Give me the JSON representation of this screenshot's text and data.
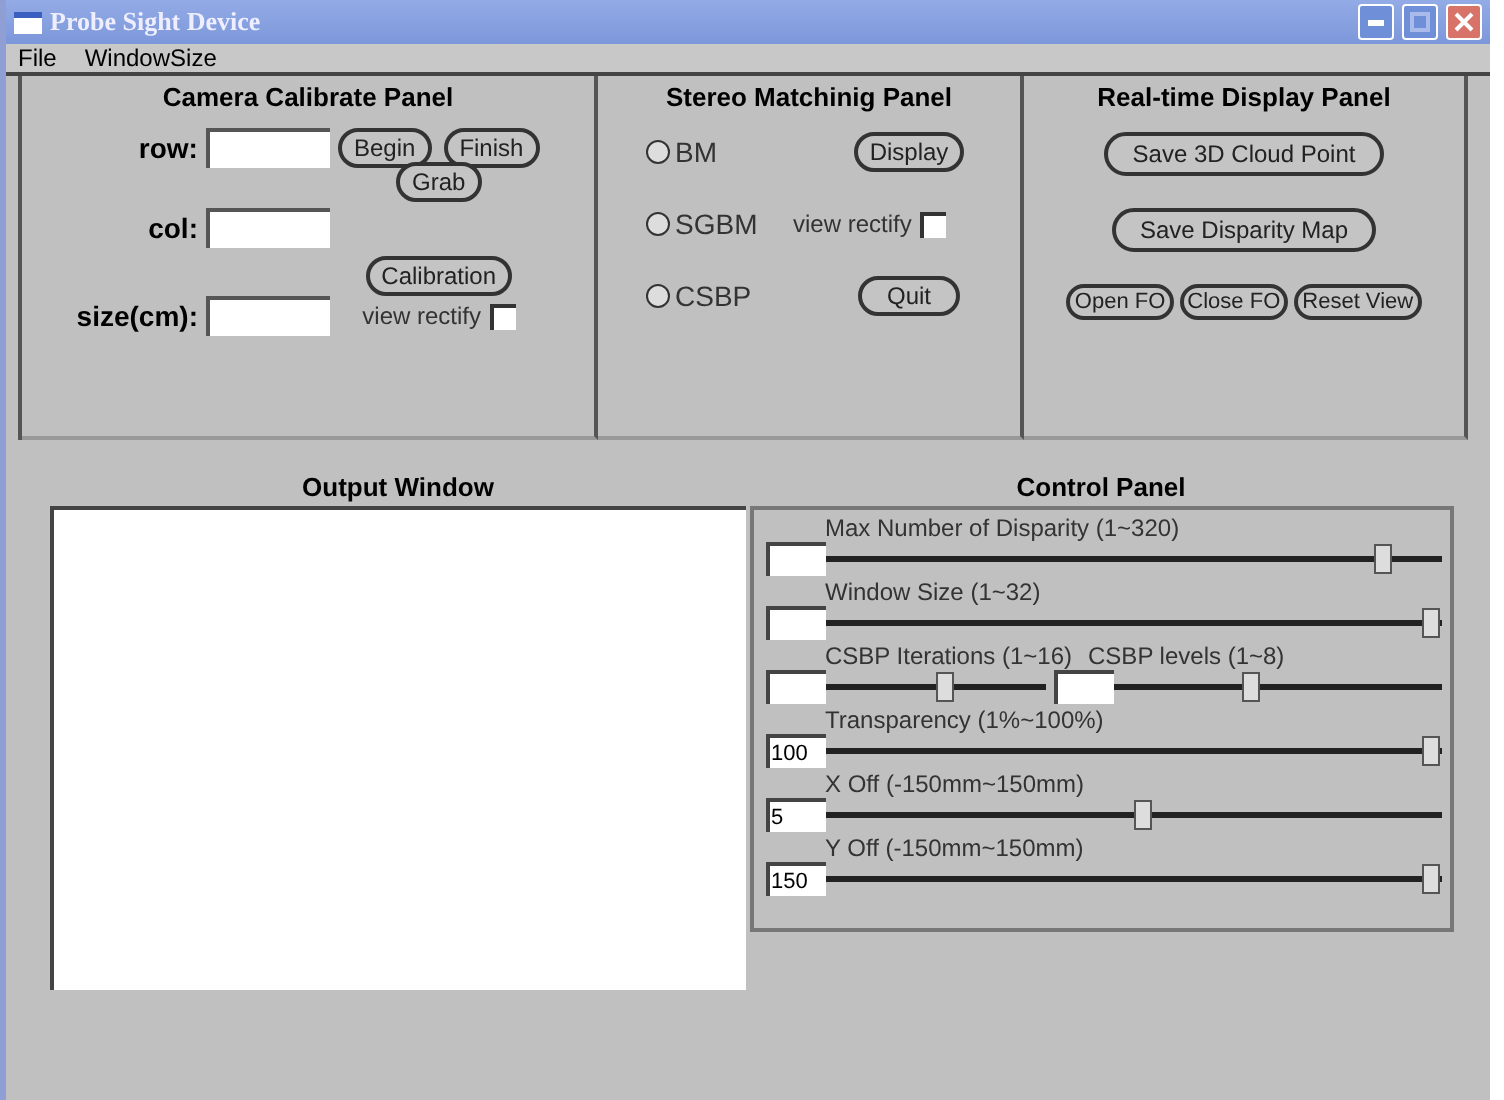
{
  "window": {
    "title": "Probe Sight Device"
  },
  "menu": [
    "File",
    "WindowSize"
  ],
  "camera_panel": {
    "title": "Camera Calibrate Panel",
    "fields": [
      {
        "label": "row:"
      },
      {
        "label": "col:"
      },
      {
        "label": "size(cm):"
      }
    ],
    "buttons": [
      "Begin",
      "Finish",
      "Grab",
      "Calibration"
    ],
    "view_rectify": {
      "label": "view rectify",
      "checked": false
    }
  },
  "stereo_panel": {
    "title": "Stereo Matchinig Panel",
    "methods": [
      {
        "label": "BM",
        "selected": false
      },
      {
        "label": "SGBM",
        "selected": false
      },
      {
        "label": "CSBP",
        "selected": false
      }
    ],
    "buttons": [
      "Display",
      "Quit"
    ],
    "view_rectify": {
      "label": "view rectify",
      "checked": false
    }
  },
  "display_panel": {
    "title": "Real-time Display Panel",
    "buttons": [
      "Save 3D Cloud Point",
      "Save Disparity Map"
    ],
    "small_buttons": [
      "Open FO",
      "Close FO",
      "Reset View"
    ]
  },
  "output_window": {
    "title": "Output Window"
  },
  "control_panel": {
    "title": "Control Panel",
    "sliders": [
      {
        "kind": "single",
        "label": "Max Number of Disparity (1~320)",
        "level": 0.92
      },
      {
        "kind": "single",
        "label": "Window Size (1~32)",
        "level": 1.0
      },
      {
        "kind": "pair",
        "parts": [
          {
            "label": "CSBP Iterations (1~16)",
            "level": 0.55
          },
          {
            "label": "CSBP levels (1~8)",
            "level": 0.42
          }
        ]
      },
      {
        "kind": "single",
        "label": "Transparency (1%~100%)",
        "value": "100",
        "level": 1.0
      },
      {
        "kind": "single",
        "label": "X Off (-150mm~150mm)",
        "value": "5",
        "level": 0.52
      },
      {
        "kind": "single",
        "label": "Y Off (-150mm~150mm)",
        "value": "150",
        "level": 1.0
      }
    ]
  }
}
